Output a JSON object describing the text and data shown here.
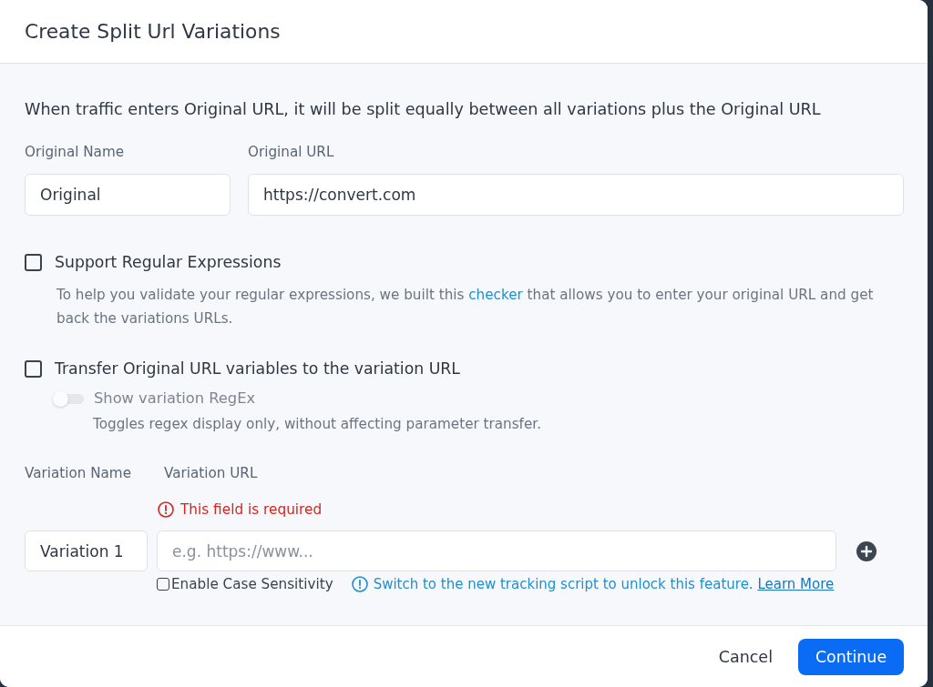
{
  "dialog": {
    "title": "Create Split Url Variations"
  },
  "description": "When traffic enters Original URL, it will be split equally between all variations plus the Original URL",
  "original": {
    "name_label": "Original Name",
    "name_value": "Original",
    "url_label": "Original URL",
    "url_value": "https://convert.com"
  },
  "options": [
    {
      "label": "Support Regular Expressions",
      "checked": false,
      "help": {
        "before": "To help you validate your regular expressions, we built this ",
        "link": "checker",
        "after": " that allows you to enter your original URL and get back the variations URLs."
      }
    },
    {
      "label": "Transfer Original URL variables to the variation URL",
      "checked": false,
      "toggle": {
        "label": "Show variation RegEx",
        "on": false,
        "disabled": true,
        "help": "Toggles regex display only, without affecting parameter transfer."
      }
    }
  ],
  "variation_columns": [
    "Variation Name",
    "Variation URL"
  ],
  "variations": [
    {
      "name": "Variation 1",
      "url_placeholder": "e.g. https://www...",
      "error": "This field is required",
      "case_sensitivity": {
        "label": "Enable Case Sensitivity",
        "checked": false
      },
      "notice": {
        "text": "Switch to the new tracking script to unlock this feature. ",
        "link": "Learn More"
      }
    }
  ],
  "buttons": [
    {
      "label": "Cancel",
      "kind": "secondary"
    },
    {
      "label": "Continue",
      "kind": "primary"
    }
  ]
}
